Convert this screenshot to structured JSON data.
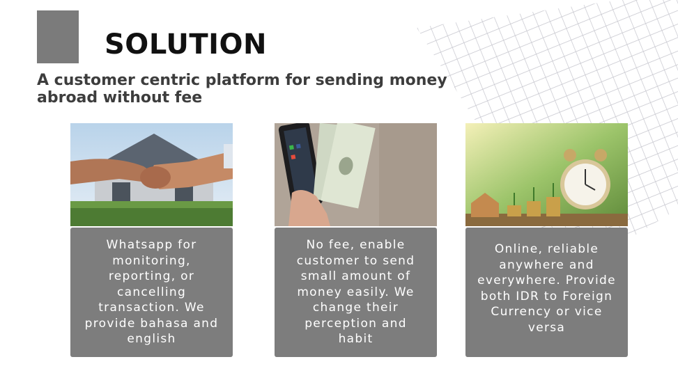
{
  "slide": {
    "title": "SOLUTION",
    "subtitle": "A customer centric platform for sending money abroad without fee"
  },
  "cards": [
    {
      "image": "handshake-house-photo",
      "text": "Whatsapp for monitoring, reporting, or cancelling transaction.  We provide bahasa and english"
    },
    {
      "image": "phone-dollar-bills-photo",
      "text": "No fee, enable customer to send small amount of money easily. We change their perception and habit"
    },
    {
      "image": "clock-coins-plants-photo",
      "text": "Online, reliable anywhere and everywhere. Provide both IDR to Foreign Currency or vice versa"
    }
  ],
  "colors": {
    "accent_square": "#7b7b7b",
    "card_bg": "#7d7d7d",
    "title": "#111111",
    "subtitle": "#3d3d3d",
    "grid_lines": "#c9c9cf"
  }
}
